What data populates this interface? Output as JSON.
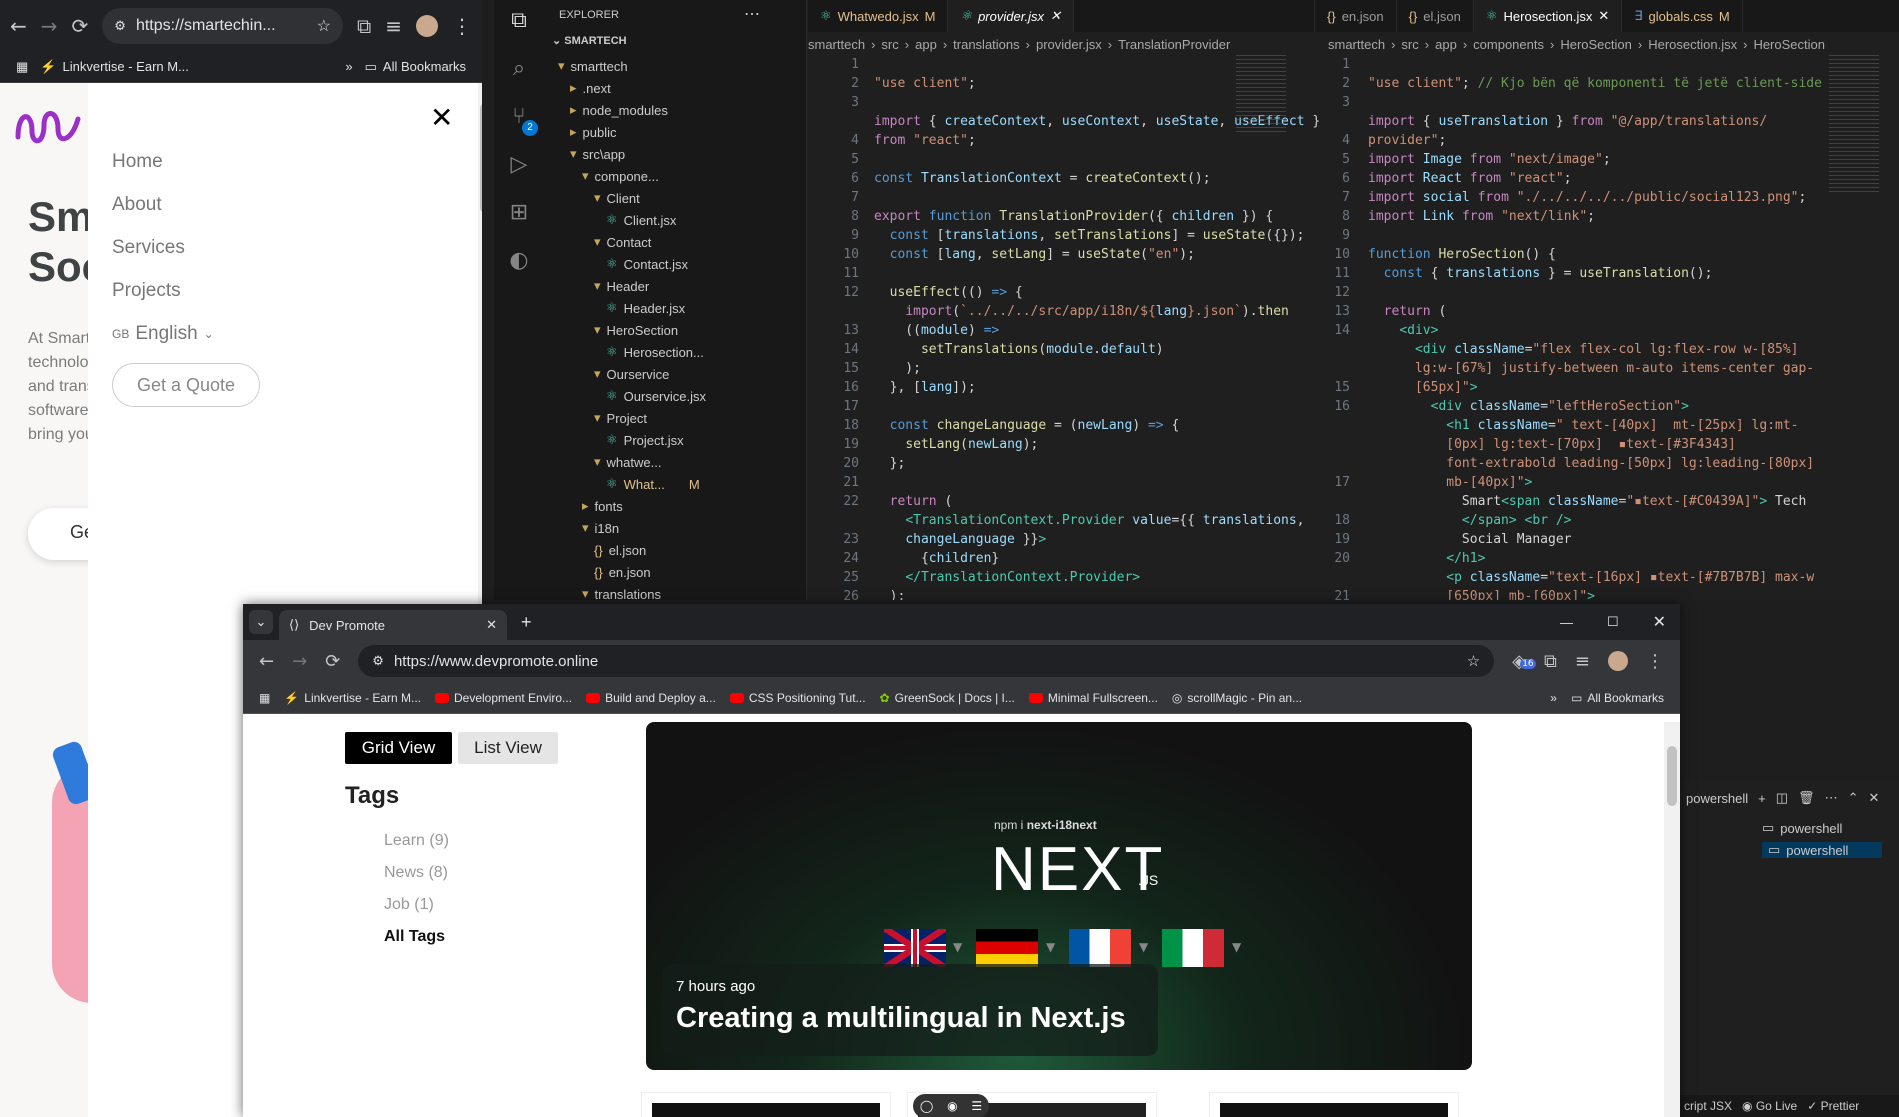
{
  "left_browser": {
    "url": "https://smartechin...",
    "bookmark1": "Linkvertise - Earn M...",
    "all_bookmarks": "All Bookmarks",
    "menu": [
      "Home",
      "About",
      "Services",
      "Projects"
    ],
    "language": "English",
    "lang_flag": "GB",
    "quote": "Get a Quote",
    "hero_line1": "Sm",
    "hero_line2": "Soc",
    "body_lines": [
      "At Smart",
      "technolo",
      "and trans",
      "software",
      "bring you"
    ],
    "cta": "Ge"
  },
  "vscode": {
    "explorer_title": "EXPLORER",
    "root": "SMARTECH",
    "tree": [
      {
        "label": "smarttech",
        "indent": 0,
        "type": "folder-open"
      },
      {
        "label": ".next",
        "indent": 1,
        "type": "folder"
      },
      {
        "label": "node_modules",
        "indent": 1,
        "type": "folder"
      },
      {
        "label": "public",
        "indent": 1,
        "type": "folder"
      },
      {
        "label": "src\\app",
        "indent": 1,
        "type": "folder-open"
      },
      {
        "label": "compone...",
        "indent": 2,
        "type": "folder-open"
      },
      {
        "label": "Client",
        "indent": 3,
        "type": "folder-open"
      },
      {
        "label": "Client.jsx",
        "indent": 4,
        "type": "file"
      },
      {
        "label": "Contact",
        "indent": 3,
        "type": "folder-open"
      },
      {
        "label": "Contact.jsx",
        "indent": 4,
        "type": "file"
      },
      {
        "label": "Header",
        "indent": 3,
        "type": "folder-open"
      },
      {
        "label": "Header.jsx",
        "indent": 4,
        "type": "file"
      },
      {
        "label": "HeroSection",
        "indent": 3,
        "type": "folder-open"
      },
      {
        "label": "Herosection...",
        "indent": 4,
        "type": "file"
      },
      {
        "label": "Ourservice",
        "indent": 3,
        "type": "folder-open"
      },
      {
        "label": "Ourservice.jsx",
        "indent": 4,
        "type": "file"
      },
      {
        "label": "Project",
        "indent": 3,
        "type": "folder-open"
      },
      {
        "label": "Project.jsx",
        "indent": 4,
        "type": "file"
      },
      {
        "label": "whatwe...",
        "indent": 3,
        "type": "folder-open"
      },
      {
        "label": "What...",
        "indent": 4,
        "type": "file"
      },
      {
        "label": "fonts",
        "indent": 2,
        "type": "folder"
      },
      {
        "label": "i18n",
        "indent": 2,
        "type": "folder-open"
      },
      {
        "label": "el.json",
        "indent": 3,
        "type": "json"
      },
      {
        "label": "en.json",
        "indent": 3,
        "type": "json"
      },
      {
        "label": "translations",
        "indent": 2,
        "type": "folder-open"
      }
    ],
    "modified_marker": "M",
    "badge_count": "2",
    "left_tabs": [
      {
        "label": "Whatwedo.jsx",
        "mark": "M"
      },
      {
        "label": "provider.jsx",
        "mark": ""
      }
    ],
    "right_tabs": [
      "en.json",
      "el.json",
      "Herosection.jsx",
      "globals.css"
    ],
    "right_tab_mark": "M",
    "left_crumb": [
      "smarttech",
      "src",
      "app",
      "translations",
      "provider.jsx",
      "TranslationProvider"
    ],
    "right_crumb": [
      "smarttech",
      "src",
      "app",
      "components",
      "HeroSection",
      "Herosection.jsx",
      "HeroSection"
    ],
    "left_lines": [
      "1",
      "2",
      "3",
      "",
      "4",
      "5",
      "6",
      "7",
      "8",
      "9",
      "10",
      "11",
      "12",
      "",
      "13",
      "14",
      "15",
      "16",
      "17",
      "18",
      "19",
      "20",
      "21",
      "22",
      "",
      "23",
      "24",
      "25",
      "26"
    ],
    "right_lines": [
      "1",
      "2",
      "3",
      "",
      "4",
      "5",
      "6",
      "7",
      "8",
      "9",
      "10",
      "11",
      "12",
      "13",
      "14",
      "",
      "",
      "15",
      "16",
      "",
      "",
      "",
      "17",
      "",
      "18",
      "19",
      "20",
      "",
      "21"
    ],
    "terminal": {
      "title": "powershell",
      "items": [
        "powershell",
        "powershell"
      ]
    },
    "status": [
      "cript JSX",
      "Go Live",
      "Prettier"
    ]
  },
  "devpromote": {
    "tab_title": "Dev Promote",
    "url": "https://www.devpromote.online",
    "ext_badge": "16",
    "bookmarks": [
      "Linkvertise - Earn M...",
      "Development Enviro...",
      "Build and Deploy a...",
      "CSS Positioning Tut...",
      "GreenSock | Docs | I...",
      "Minimal Fullscreen...",
      "scrollMagic - Pin an..."
    ],
    "all_bookmarks": "All Bookmarks",
    "grid_view": "Grid View",
    "list_view": "List View",
    "tags_title": "Tags",
    "tags": [
      "Learn (9)",
      "News (8)",
      "Job (1)"
    ],
    "all_tags": "All Tags",
    "card": {
      "npm_prefix": "npm i",
      "npm_pkg": "next-i18next",
      "logo": "NEXT",
      "logo_sub": ".JS",
      "time": "7 hours ago",
      "title": "Creating a multilingual in Next.js"
    }
  }
}
